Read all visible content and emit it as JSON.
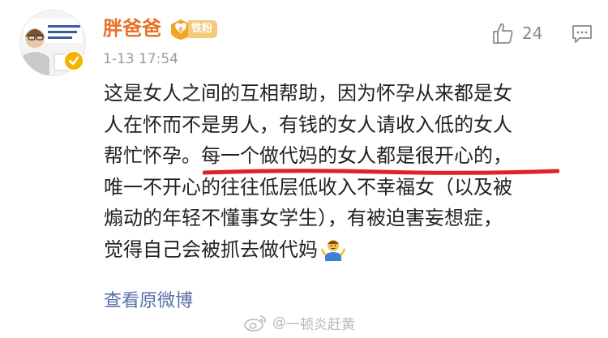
{
  "post": {
    "author": {
      "name": "胖爸爸",
      "fan_badge": "铁粉",
      "avatar_icon": "avatar-portrait",
      "verified_icon": "verified-badge-icon"
    },
    "timestamp": "1-13 17:54",
    "likes": "24",
    "body_lines": [
      "这是女人之间的互相帮助，因为怀孕从来都是女",
      "人在怀而不是男人，有钱的女人请收入低的女人",
      "帮忙怀孕。每一个做代妈的女人都是很开心的，",
      "唯一不开心的往往低层低收入不幸福女（以及被",
      "煽动的年轻不懂事女学生），有被迫害妄想症，",
      "觉得自己会被抓去做代妈"
    ],
    "emoji": "person-shrugging-emoji",
    "view_original": "查看原微博"
  },
  "watermark": {
    "text": "一顿炎赶黄",
    "icon": "weibo-logo-icon"
  },
  "colors": {
    "author_name": "#e8712a",
    "link": "#5b6fa6",
    "underline": "#e0202a",
    "meta": "#9a9a9a"
  }
}
